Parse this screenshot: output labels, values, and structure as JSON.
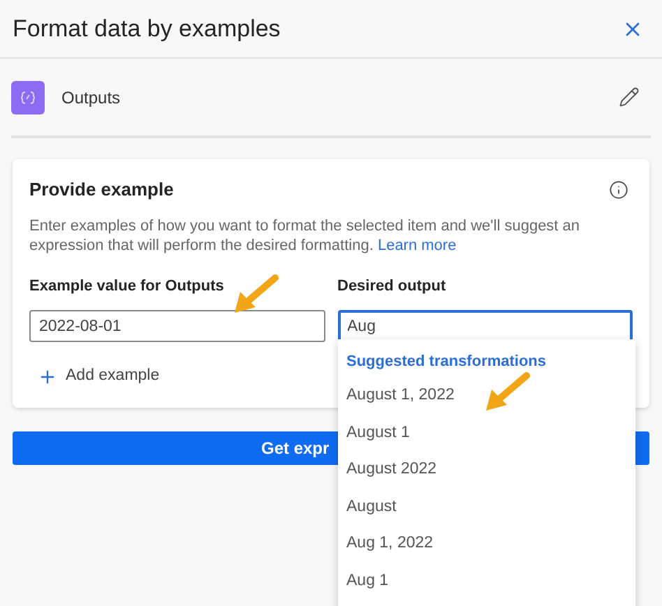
{
  "window": {
    "title": "Format data by examples"
  },
  "source": {
    "label": "Outputs"
  },
  "card": {
    "title": "Provide example",
    "description": "Enter examples of how you want to format the selected item and we'll suggest an expression that will perform the desired formatting.",
    "link": "Learn more",
    "example_label": "Example value for Outputs",
    "example_value": "2022-08-01",
    "output_label": "Desired output",
    "output_value": "Aug",
    "add_label": "Add example"
  },
  "primary_button": "Get expr",
  "suggestions": {
    "heading": "Suggested transformations",
    "items": [
      "August 1, 2022",
      "August 1",
      "August 2022",
      "August",
      "Aug 1, 2022",
      "Aug 1"
    ]
  }
}
